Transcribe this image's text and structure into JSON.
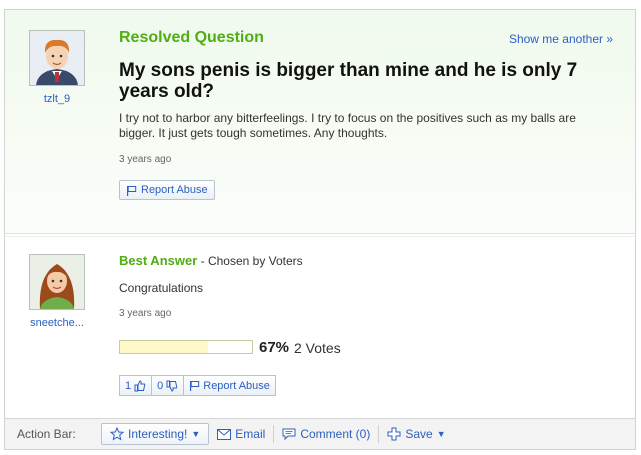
{
  "question": {
    "section_label": "Resolved Question",
    "show_another": "Show me another »",
    "asker": "tzlt_9",
    "title": "My sons penis is bigger than mine and he is only 7 years old?",
    "body": "I try not to harbor any bitterfeelings. I try to focus on the positives such as my balls are bigger. It just gets tough sometimes. Any thoughts.",
    "time": "3 years ago",
    "report_abuse": "Report Abuse"
  },
  "answer": {
    "label": "Best Answer",
    "chosen_by": " - Chosen by Voters",
    "answerer": "sneetche...",
    "text": "Congratulations",
    "time": "3 years ago",
    "vote_percent": "67%",
    "vote_fraction": 0.67,
    "vote_count": "2 Votes",
    "thumbs_up": "1",
    "thumbs_down": "0",
    "report_abuse": "Report Abuse"
  },
  "action_bar": {
    "label": "Action Bar:",
    "interesting": "Interesting!",
    "email": "Email",
    "comment": "Comment (0)",
    "save": "Save"
  },
  "colors": {
    "accent_green": "#4fae12",
    "link_blue": "#2c60c0"
  }
}
